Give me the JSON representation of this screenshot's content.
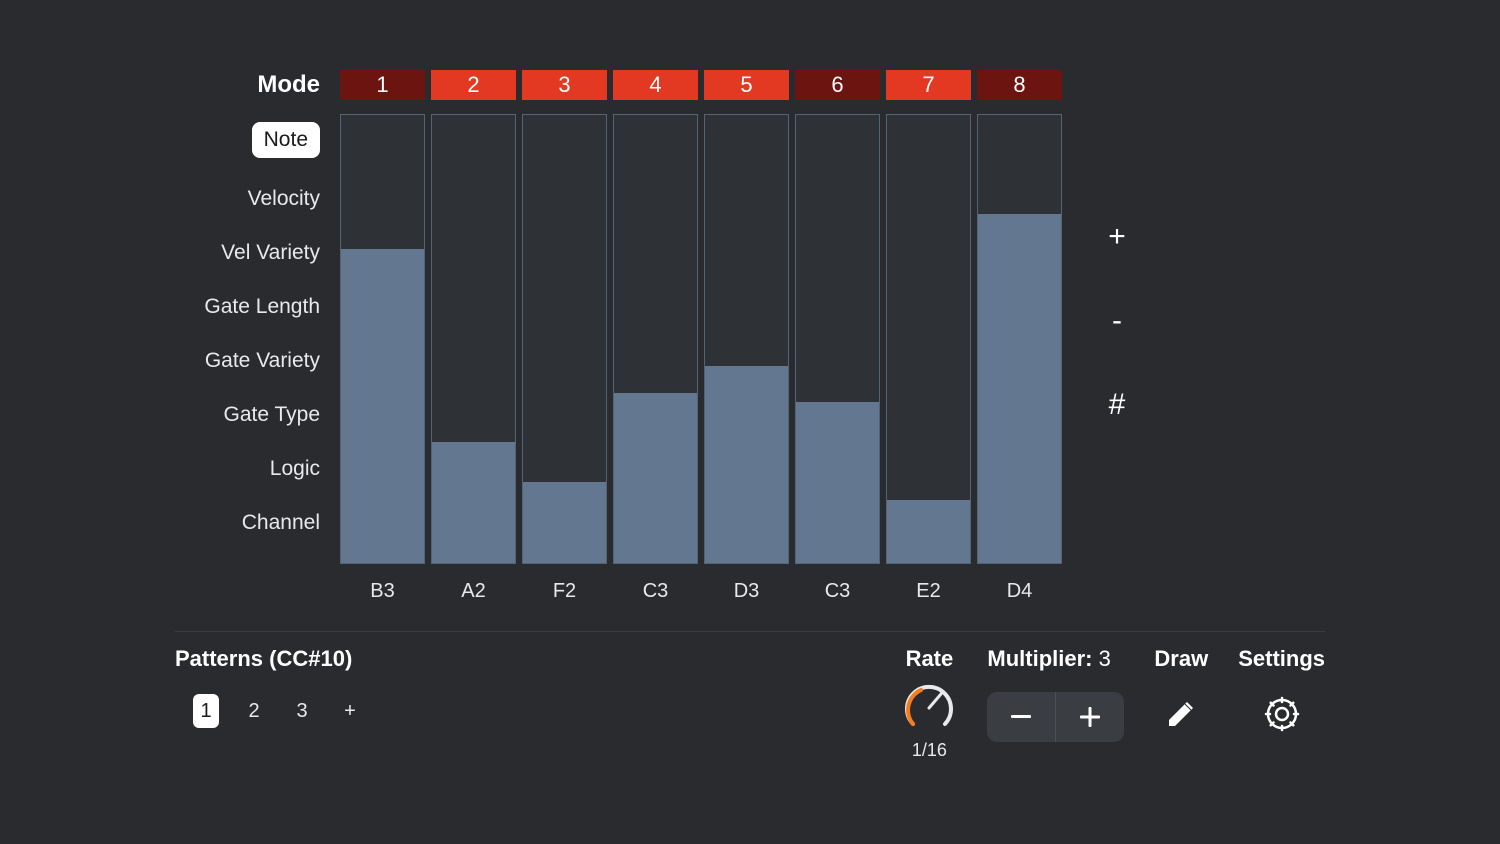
{
  "mode": {
    "header": "Mode",
    "items": [
      {
        "label": "Note",
        "active": true
      },
      {
        "label": "Velocity",
        "active": false
      },
      {
        "label": "Vel Variety",
        "active": false
      },
      {
        "label": "Gate Length",
        "active": false
      },
      {
        "label": "Gate Variety",
        "active": false
      },
      {
        "label": "Gate Type",
        "active": false
      },
      {
        "label": "Logic",
        "active": false
      },
      {
        "label": "Channel",
        "active": false
      }
    ]
  },
  "steps": [
    {
      "number": "1",
      "bright": false,
      "fill": 70,
      "label": "B3"
    },
    {
      "number": "2",
      "bright": true,
      "fill": 27,
      "label": "A2"
    },
    {
      "number": "3",
      "bright": true,
      "fill": 18,
      "label": "F2"
    },
    {
      "number": "4",
      "bright": true,
      "fill": 38,
      "label": "C3"
    },
    {
      "number": "5",
      "bright": true,
      "fill": 44,
      "label": "D3"
    },
    {
      "number": "6",
      "bright": false,
      "fill": 36,
      "label": "C3"
    },
    {
      "number": "7",
      "bright": true,
      "fill": 14,
      "label": "E2"
    },
    {
      "number": "8",
      "bright": false,
      "fill": 78,
      "label": "D4"
    }
  ],
  "side_buttons": {
    "plus": "+",
    "minus": "-",
    "sharp": "#"
  },
  "patterns": {
    "label": "Patterns (CC#10)",
    "items": [
      "1",
      "2",
      "3"
    ],
    "add": "+"
  },
  "rate": {
    "label": "Rate",
    "value": "1/16"
  },
  "multiplier": {
    "label": "Multiplier: ",
    "value": "3"
  },
  "draw": {
    "label": "Draw"
  },
  "settings": {
    "label": "Settings"
  }
}
